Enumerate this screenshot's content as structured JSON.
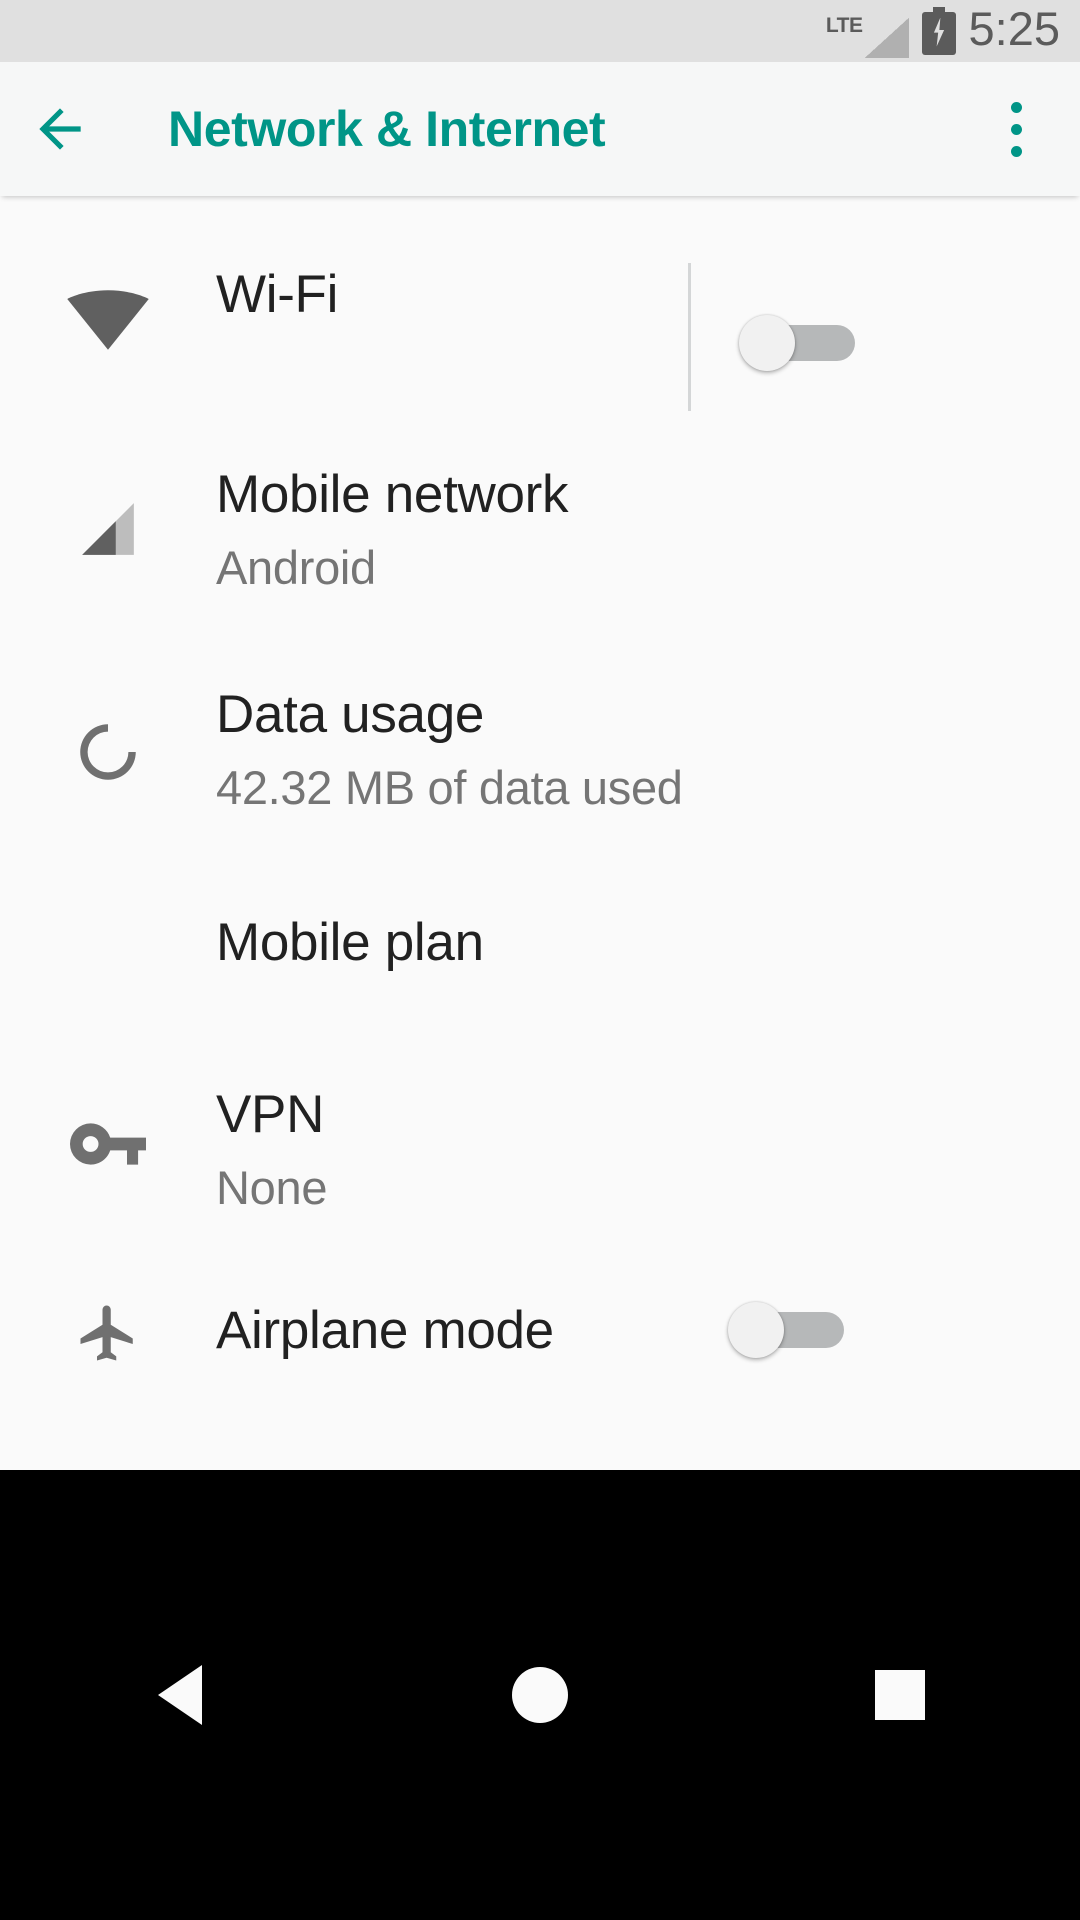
{
  "status_bar": {
    "network_type": "LTE",
    "signal_icon": "signal-cellular-0-bar-icon",
    "battery_icon": "battery-charging-icon",
    "time": "5:25",
    "bg_color": "#e0e0e0",
    "fg_color": "#5b5b5b"
  },
  "app_bar": {
    "back_icon": "arrow-back-icon",
    "title": "Network & Internet",
    "overflow_icon": "more-vert-icon",
    "accent_color": "#009587",
    "bg_color": "#f6f7f7"
  },
  "list": {
    "items": [
      {
        "key": "wifi",
        "icon": "wifi-icon",
        "title": "Wi-Fi",
        "subtitle": "",
        "has_switch": true,
        "switch_on": false,
        "has_divider": true
      },
      {
        "key": "mobile-network",
        "icon": "signal-cellular-icon",
        "title": "Mobile network",
        "subtitle": "Android",
        "has_switch": false,
        "switch_on": false,
        "has_divider": false
      },
      {
        "key": "data-usage",
        "icon": "data-usage-icon",
        "title": "Data usage",
        "subtitle": "42.32 MB of data used",
        "has_switch": false,
        "switch_on": false,
        "has_divider": false
      },
      {
        "key": "mobile-plan",
        "icon": "",
        "title": "Mobile plan",
        "subtitle": "",
        "has_switch": false,
        "switch_on": false,
        "has_divider": false
      },
      {
        "key": "vpn",
        "icon": "vpn-key-icon",
        "title": "VPN",
        "subtitle": "None",
        "has_switch": false,
        "switch_on": false,
        "has_divider": false
      },
      {
        "key": "airplane-mode",
        "icon": "airplanemode-icon",
        "title": "Airplane mode",
        "subtitle": "",
        "has_switch": true,
        "switch_on": false,
        "has_divider": false
      }
    ]
  },
  "nav_bar": {
    "back_icon": "nav-back-icon",
    "home_icon": "nav-home-icon",
    "recents_icon": "nav-recents-icon",
    "bg_color": "#000000"
  }
}
